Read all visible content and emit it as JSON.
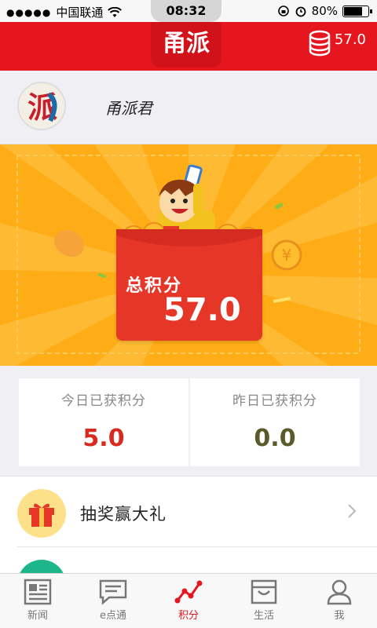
{
  "status_bar": {
    "carrier": "中国联通",
    "time": "08:32",
    "battery": "80%",
    "battery_level": 0.8
  },
  "header": {
    "logo": "甬派",
    "coin_balance": "57.0"
  },
  "user": {
    "avatar_text": "派",
    "name": "甬派君"
  },
  "banner": {
    "total_label": "总积分",
    "total_value": "57.0",
    "coin_symbol": "¥"
  },
  "stats": [
    {
      "label": "今日已获积分",
      "value": "5.0",
      "color": "#d72a21"
    },
    {
      "label": "昨日已获积分",
      "value": "0.0",
      "color": "#5a5a2a"
    }
  ],
  "list": {
    "items": [
      {
        "label": "抽奖赢大礼",
        "icon": "gift-icon"
      }
    ]
  },
  "tabs": [
    {
      "label": "新闻",
      "icon": "newspaper-icon",
      "active": false
    },
    {
      "label": "e点通",
      "icon": "chat-icon",
      "active": false
    },
    {
      "label": "积分",
      "icon": "trend-icon",
      "active": true
    },
    {
      "label": "生活",
      "icon": "shop-icon",
      "active": false
    },
    {
      "label": "我",
      "icon": "person-icon",
      "active": false
    }
  ],
  "colors": {
    "brand_red": "#e5161d",
    "banner_orange": "#ffad16",
    "envelope_red": "#e63628"
  }
}
